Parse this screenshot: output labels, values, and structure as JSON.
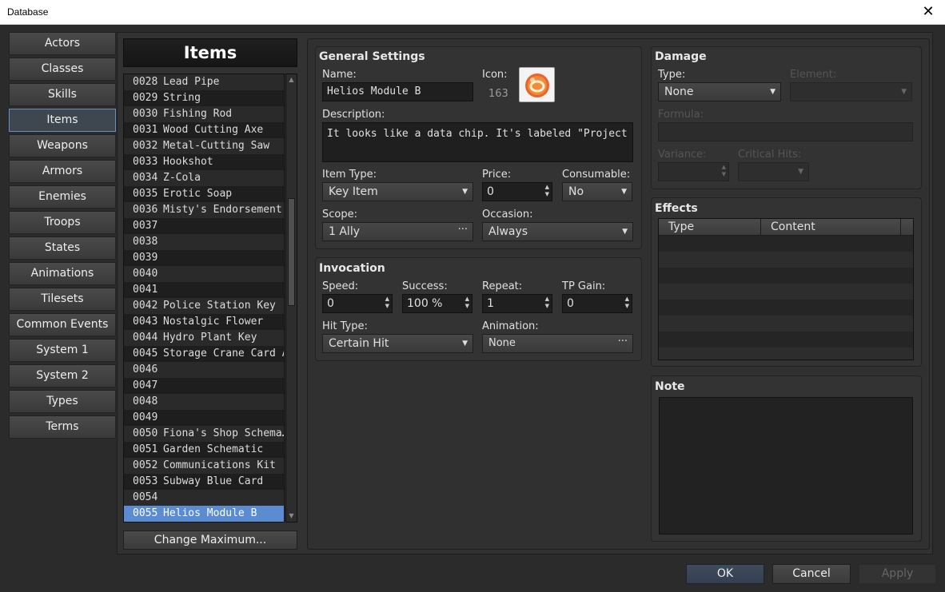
{
  "window": {
    "title": "Database",
    "close_glyph": "✕"
  },
  "nav": {
    "items": [
      {
        "label": "Actors"
      },
      {
        "label": "Classes"
      },
      {
        "label": "Skills"
      },
      {
        "label": "Items",
        "selected": true
      },
      {
        "label": "Weapons"
      },
      {
        "label": "Armors"
      },
      {
        "label": "Enemies"
      },
      {
        "label": "Troops"
      },
      {
        "label": "States"
      },
      {
        "label": "Animations"
      },
      {
        "label": "Tilesets"
      },
      {
        "label": "Common Events"
      },
      {
        "label": "System 1"
      },
      {
        "label": "System 2"
      },
      {
        "label": "Types"
      },
      {
        "label": "Terms"
      }
    ]
  },
  "list": {
    "header": "Items",
    "rows": [
      {
        "id": "0028",
        "name": "Lead Pipe"
      },
      {
        "id": "0029",
        "name": "String"
      },
      {
        "id": "0030",
        "name": "Fishing Rod"
      },
      {
        "id": "0031",
        "name": "Wood Cutting Axe"
      },
      {
        "id": "0032",
        "name": "Metal-Cutting Saw"
      },
      {
        "id": "0033",
        "name": "Hookshot"
      },
      {
        "id": "0034",
        "name": "Z-Cola"
      },
      {
        "id": "0035",
        "name": "Erotic Soap"
      },
      {
        "id": "0036",
        "name": "Misty's Endorsement"
      },
      {
        "id": "0037",
        "name": ""
      },
      {
        "id": "0038",
        "name": ""
      },
      {
        "id": "0039",
        "name": ""
      },
      {
        "id": "0040",
        "name": ""
      },
      {
        "id": "0041",
        "name": ""
      },
      {
        "id": "0042",
        "name": "Police Station Key"
      },
      {
        "id": "0043",
        "name": "Nostalgic Flower"
      },
      {
        "id": "0044",
        "name": "Hydro Plant Key"
      },
      {
        "id": "0045",
        "name": "Storage Crane Card A"
      },
      {
        "id": "0046",
        "name": ""
      },
      {
        "id": "0047",
        "name": ""
      },
      {
        "id": "0048",
        "name": ""
      },
      {
        "id": "0049",
        "name": ""
      },
      {
        "id": "0050",
        "name": "Fiona's Shop Schema…"
      },
      {
        "id": "0051",
        "name": "Garden Schematic"
      },
      {
        "id": "0052",
        "name": "Communications Kit"
      },
      {
        "id": "0053",
        "name": "Subway Blue Card"
      },
      {
        "id": "0054",
        "name": ""
      },
      {
        "id": "0055",
        "name": "Helios Module B",
        "selected": true
      }
    ],
    "change_max_label": "Change Maximum..."
  },
  "general": {
    "title": "General Settings",
    "name_label": "Name:",
    "name_value": "Helios Module B",
    "icon_label": "Icon:",
    "icon_index": "163",
    "icon_name": "orange-disc-icon",
    "description_label": "Description:",
    "description_value": "It looks like a data chip. It's labeled \"Project Helio",
    "item_type_label": "Item Type:",
    "item_type_value": "Key Item",
    "price_label": "Price:",
    "price_value": "0",
    "consumable_label": "Consumable:",
    "consumable_value": "No",
    "scope_label": "Scope:",
    "scope_value": "1 Ally",
    "occasion_label": "Occasion:",
    "occasion_value": "Always"
  },
  "invocation": {
    "title": "Invocation",
    "speed_label": "Speed:",
    "speed_value": "0",
    "success_label": "Success:",
    "success_value": "100 %",
    "repeat_label": "Repeat:",
    "repeat_value": "1",
    "tp_label": "TP Gain:",
    "tp_value": "0",
    "hit_type_label": "Hit Type:",
    "hit_type_value": "Certain Hit",
    "animation_label": "Animation:",
    "animation_value": "None"
  },
  "damage": {
    "title": "Damage",
    "type_label": "Type:",
    "type_value": "None",
    "element_label": "Element:",
    "formula_label": "Formula:",
    "variance_label": "Variance:",
    "critical_label": "Critical Hits:"
  },
  "effects": {
    "title": "Effects",
    "col_type": "Type",
    "col_content": "Content"
  },
  "note": {
    "title": "Note"
  },
  "footer": {
    "ok": "OK",
    "cancel": "Cancel",
    "apply": "Apply"
  },
  "colors": {
    "selection": "#5b8bd1",
    "background": "#2b2b2b"
  }
}
